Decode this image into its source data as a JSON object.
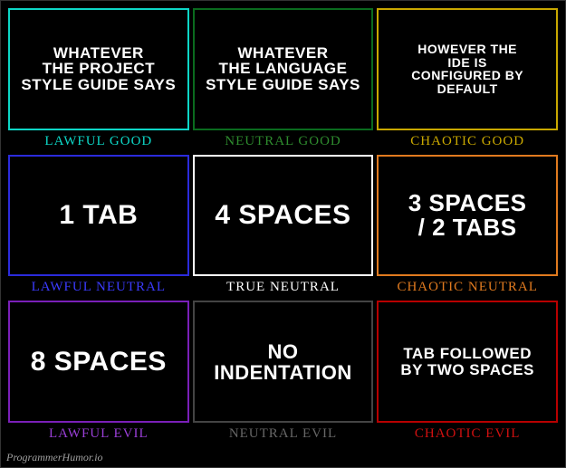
{
  "watermark": "ProgrammerHumor.io",
  "cells": [
    {
      "alignment": "LAWFUL GOOD",
      "content": "WHATEVER\nTHE PROJECT\nSTYLE GUIDE SAYS",
      "class": "lg",
      "size": "fs-sm"
    },
    {
      "alignment": "NEUTRAL GOOD",
      "content": "WHATEVER\nTHE LANGUAGE\nSTYLE GUIDE SAYS",
      "class": "ng",
      "size": "fs-sm"
    },
    {
      "alignment": "CHAOTIC GOOD",
      "content": "HOWEVER THE\nIDE IS\nCONFIGURED BY DEFAULT",
      "class": "cg",
      "size": "fs-xs"
    },
    {
      "alignment": "LAWFUL NEUTRAL",
      "content": "1 TAB",
      "class": "ln",
      "size": "fs-lg"
    },
    {
      "alignment": "TRUE NEUTRAL",
      "content": "4 SPACES",
      "class": "tn",
      "size": "fs-lg"
    },
    {
      "alignment": "CHAOTIC NEUTRAL",
      "content": "3 SPACES\n/ 2 TABS",
      "class": "cn",
      "size": "fs-xl"
    },
    {
      "alignment": "LAWFUL EVIL",
      "content": "8 SPACES",
      "class": "le",
      "size": "fs-lg"
    },
    {
      "alignment": "NEUTRAL EVIL",
      "content": "NO\nINDENTATION",
      "class": "ne",
      "size": "fs-md"
    },
    {
      "alignment": "CHAOTIC EVIL",
      "content": "TAB FOLLOWED\nBY TWO SPACES",
      "class": "ce",
      "size": "fs-sm"
    }
  ],
  "colors": {
    "lawful_good": "#0dd6c6",
    "neutral_good": "#2e8b2e",
    "chaotic_good": "#c9a800",
    "lawful_neutral": "#3b3bff",
    "true_neutral": "#ffffff",
    "chaotic_neutral": "#e07a1f",
    "lawful_evil": "#9a3fd8",
    "neutral_evil": "#666666",
    "chaotic_evil": "#d01010"
  }
}
